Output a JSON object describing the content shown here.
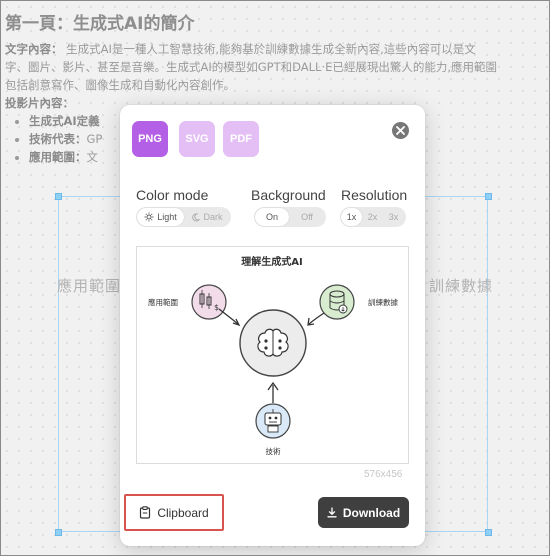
{
  "document": {
    "title": "第一頁：生成式AI的簡介",
    "content_label": "文字內容：",
    "content_line1": "生成式AI是一種人工智慧技術,能夠基於訓練數據生成全新內容,這些內容可以是文",
    "content_line2": "字、圖片、影片、甚至是音樂。生成式AI的模型如GPT和DALL·E已經展現出驚人的能力,應用範圍",
    "content_line3": "包括創意寫作、圖像生成和自動化內容創作。",
    "slide_label": "投影片內容：",
    "bullets": [
      {
        "label": "生成式AI定義",
        "text": ""
      },
      {
        "label": "技術代表：",
        "text": "GP"
      },
      {
        "label": "應用範圍：",
        "text": "文"
      }
    ]
  },
  "canvas": {
    "left_label": "應用範圍",
    "right_label": "訓練數據"
  },
  "dialog": {
    "formats": [
      {
        "label": "PNG",
        "selected": true
      },
      {
        "label": "SVG",
        "selected": false
      },
      {
        "label": "PDF",
        "selected": false
      }
    ],
    "color_mode": {
      "label": "Color mode",
      "options": [
        "Light",
        "Dark"
      ],
      "selected": "Light"
    },
    "background": {
      "label": "Background",
      "options": [
        "On",
        "Off"
      ],
      "selected": "On"
    },
    "resolution": {
      "label": "Resolution",
      "options": [
        "1x",
        "2x",
        "3x"
      ],
      "selected": "1x"
    },
    "preview": {
      "title": "理解生成式AI",
      "left_node": "應用範圍",
      "right_node": "訓練數據",
      "bottom_node": "技術"
    },
    "dimensions": "576x456",
    "clipboard_label": "Clipboard",
    "download_label": "Download"
  },
  "colors": {
    "accent": "#b35fe6",
    "accent_light": "#e3bff5",
    "highlight_border": "#d9534f",
    "primary_button": "#3f3f3f"
  }
}
